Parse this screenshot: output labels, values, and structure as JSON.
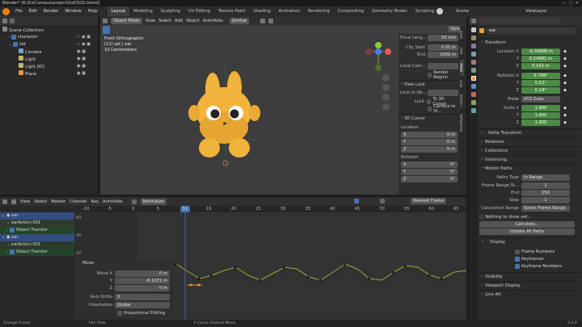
{
  "window": {
    "title": "Blender* [K:\\ExtCampus\\project\\Go03\\02.blend]"
  },
  "menus": [
    "File",
    "Edit",
    "Render",
    "Window",
    "Help"
  ],
  "workspaces": [
    "Layout",
    "Modeling",
    "Sculpting",
    "UV Editing",
    "Texture Paint",
    "Shading",
    "Animation",
    "Rendering",
    "Compositing",
    "Geometry Nodes",
    "Scripting"
  ],
  "active_workspace": "Layout",
  "scene": {
    "label": "Scene",
    "view_layer": "ViewLayer"
  },
  "outliner": {
    "items": [
      {
        "label": "Scene Collection",
        "depth": 0
      },
      {
        "label": "character",
        "depth": 1
      },
      {
        "label": "set",
        "depth": 1
      },
      {
        "label": "Camera",
        "depth": 2
      },
      {
        "label": "Light",
        "depth": 2
      },
      {
        "label": "Light.001",
        "depth": 2
      },
      {
        "label": "Plane",
        "depth": 2
      }
    ]
  },
  "viewport": {
    "mode": "Object Mode",
    "menus": [
      "View",
      "Select",
      "Add",
      "Object",
      "AnimAide"
    ],
    "orientation": "Gimbal",
    "options": "Options",
    "overlay_title": "Front Orthographic",
    "overlay_line2": "(11) set | ear",
    "overlay_line3": "10 Centimeters",
    "tabs": [
      "Item",
      "Tool",
      "View",
      "ARP",
      "Create",
      "AnimAide"
    ]
  },
  "view_panel": {
    "focal_length": {
      "label": "Focal Leng...",
      "value": "50 mm"
    },
    "clip_start": {
      "label": "Clip Start",
      "value": "0.01 m"
    },
    "clip_end": {
      "label": "End",
      "value": "1000 m"
    },
    "local_camera": "Local Cam...",
    "render_region": "Render Region",
    "view_lock_title": "View Lock",
    "lock_to_obj": "Lock to Ob...",
    "lock_label": "Lock",
    "to_3d_cursor": "To 3D Cursor",
    "camera_to_view": "Camera to Vi...",
    "cursor_title": "3D Cursor",
    "location_label": "Location",
    "x_label": "X",
    "y_label": "Y",
    "z_label": "Z",
    "cursor_loc": [
      "0 m",
      "0 m",
      "0 m"
    ],
    "rotation_label": "Rotation",
    "cursor_rot": [
      "0°",
      "0°",
      "0°"
    ]
  },
  "graph_editor": {
    "menus": [
      "View",
      "Select",
      "Marker",
      "Channel",
      "Key",
      "AnimAide"
    ],
    "normalize": "Normalize",
    "snap": "Nearest Frame",
    "frame_ticks": [
      "-10",
      "-5",
      "0",
      "5",
      "10",
      "15",
      "20",
      "25",
      "30",
      "35",
      "40",
      "45",
      "50",
      "55",
      "60",
      "65"
    ],
    "current_frame": "11",
    "y_ticks": [
      "60",
      "40",
      "20",
      "0",
      "-20",
      "-40"
    ],
    "channels": [
      {
        "label": "ear",
        "kind": "object"
      },
      {
        "label": "earAction.001",
        "kind": "action"
      },
      {
        "label": "Object Transfor",
        "kind": "group"
      },
      {
        "label": "ear",
        "kind": "object"
      },
      {
        "label": "earAction.001",
        "kind": "action"
      },
      {
        "label": "Object Transfor",
        "kind": "group"
      }
    ]
  },
  "move_panel": {
    "title": "Move",
    "move_x": {
      "label": "Move X",
      "value": "0 m"
    },
    "y": {
      "label": "Y",
      "value": "-8.1071 m"
    },
    "z": {
      "label": "Z",
      "value": "0 m"
    },
    "axis_ortho": {
      "label": "Axis Ortho",
      "value": "X"
    },
    "orientation": {
      "label": "Orientation",
      "value": "Global"
    },
    "proportional": "Proportional Editing"
  },
  "properties": {
    "object_name": "ear",
    "transform_title": "Transform",
    "location": {
      "label": "Location X",
      "values": [
        "-0.34999 m",
        "0.14681 m",
        "5.142 m"
      ]
    },
    "rotation": {
      "label": "Rotation X",
      "values": [
        "0.708°",
        "0.52°",
        "0.24°"
      ]
    },
    "mode": {
      "label": "Mode",
      "value": "XYZ Euler"
    },
    "scale": {
      "label": "Scale X",
      "values": [
        "1.000",
        "1.000",
        "1.000"
      ]
    },
    "axis_y": "Y",
    "axis_z": "Z",
    "sections": [
      "Delta Transform",
      "Relations",
      "Collections",
      "Instancing"
    ],
    "motion_paths": {
      "title": "Motion Paths",
      "paths_type": {
        "label": "Paths Type",
        "value": "In Range"
      },
      "frame_range_start": {
        "label": "Frame Range St...",
        "value": "1"
      },
      "end": {
        "label": "End",
        "value": "250"
      },
      "step": {
        "label": "Step",
        "value": "1"
      },
      "calc_range": {
        "label": "Calculation Range",
        "value": "Scene Frame Range"
      },
      "nothing": "Nothing to show yet...",
      "calculate": "Calculate...",
      "update_all": "Update All Paths"
    },
    "display": {
      "title": "Display",
      "frame_numbers": "Frame Numbers",
      "keyframes": "Keyframes",
      "keyframe_numbers": "Keyframe Numbers"
    },
    "bottom_sections": [
      "Visibility",
      "Viewport Display",
      "Line Art"
    ]
  },
  "status": {
    "left": "Change Frame",
    "mid": "Pan View",
    "right": "F-Curve Context Menu",
    "version": "3.3.0"
  },
  "colors": {
    "accent": "#4772b3",
    "green": "#4d8a46",
    "char": "#f2b43c",
    "curve": "#9fa832"
  }
}
